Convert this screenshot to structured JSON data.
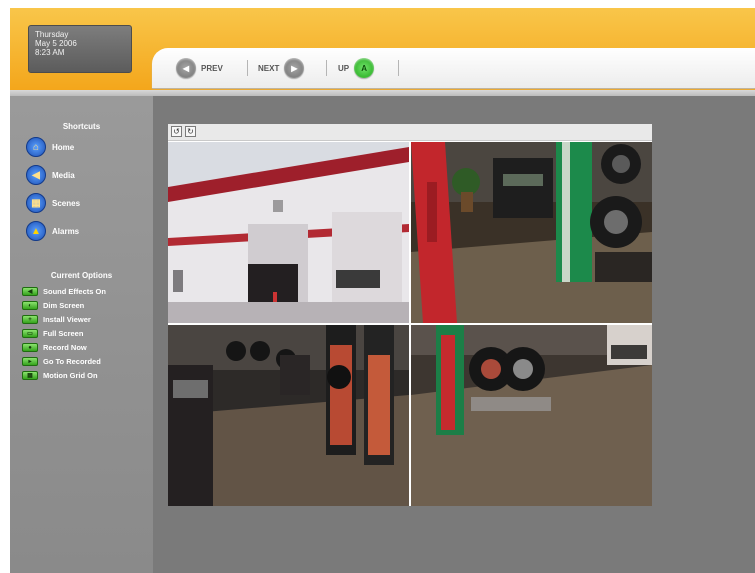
{
  "clock": {
    "day": "Thursday",
    "date": "May 5 2006",
    "time": "8:23 AM"
  },
  "toolbar": {
    "prev_label": "PREV",
    "next_label": "NEXT",
    "up_label": "UP",
    "up_icon_letter": "A"
  },
  "shortcuts": {
    "title": "Shortcuts",
    "items": [
      {
        "label": "Home",
        "icon": "home-icon"
      },
      {
        "label": "Media",
        "icon": "speaker-icon"
      },
      {
        "label": "Scenes",
        "icon": "scenes-icon"
      },
      {
        "label": "Alarms",
        "icon": "alarm-icon"
      }
    ]
  },
  "options": {
    "title": "Current Options",
    "items": [
      {
        "label": "Sound Effects On",
        "icon": "speaker-icon"
      },
      {
        "label": "Dim Screen",
        "icon": "moon-icon"
      },
      {
        "label": "Install Viewer",
        "icon": "install-icon"
      },
      {
        "label": "Full Screen",
        "icon": "fullscreen-icon"
      },
      {
        "label": "Record Now",
        "icon": "record-icon"
      },
      {
        "label": "Go To Recorded",
        "icon": "folder-icon"
      },
      {
        "label": "Motion Grid On",
        "icon": "grid-icon"
      }
    ]
  },
  "viewer": {
    "cameras": [
      {
        "name": "camera-1",
        "scene": "building exterior"
      },
      {
        "name": "camera-2",
        "scene": "tire display area"
      },
      {
        "name": "camera-3",
        "scene": "tire showroom"
      },
      {
        "name": "camera-4",
        "scene": "tire rack corner"
      }
    ]
  },
  "colors": {
    "accent": "#f3a418",
    "panel": "#7a7a7a",
    "option_green": "#36a41c",
    "shortcut_blue": "#1d4fb3"
  }
}
